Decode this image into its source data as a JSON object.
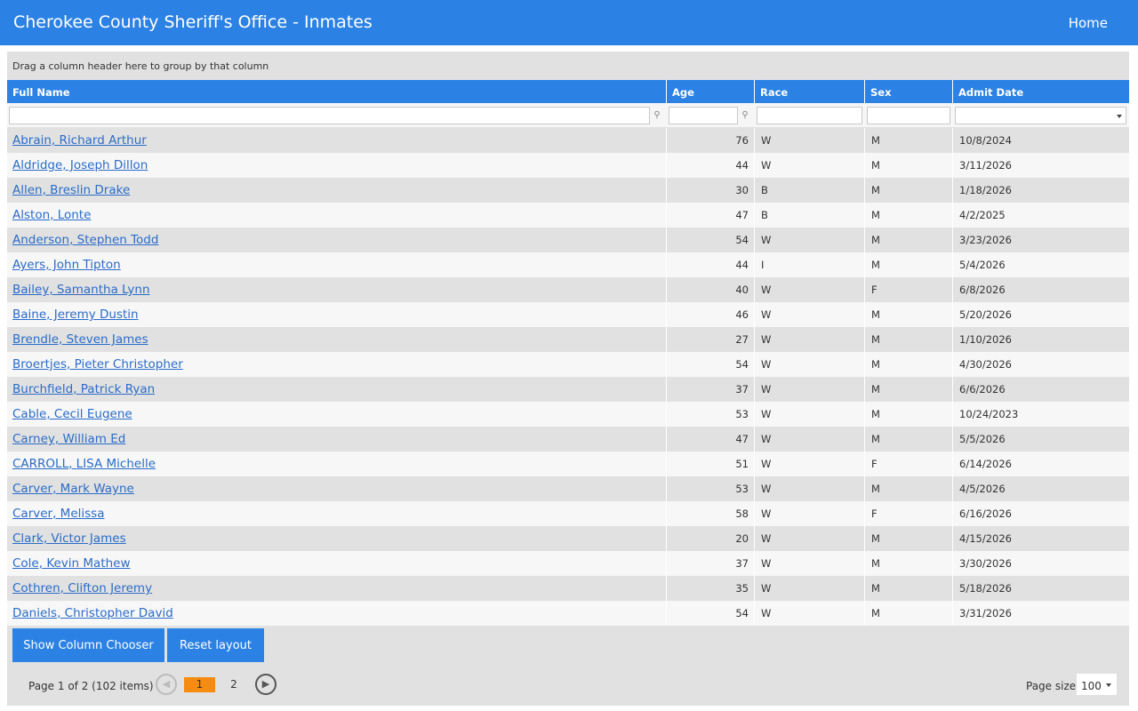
{
  "header": {
    "title": "Cherokee County Sheriff's Office - Inmates",
    "home_label": "Home"
  },
  "grid": {
    "group_panel_text": "Drag a column header here to group by that column",
    "columns": [
      "Full Name",
      "Age",
      "Race",
      "Sex",
      "Admit Date"
    ],
    "rows": [
      {
        "name": "Abrain, Richard Arthur",
        "age": "76",
        "race": "W",
        "sex": "M",
        "admit": "10/8/2024"
      },
      {
        "name": "Aldridge, Joseph Dillon",
        "age": "44",
        "race": "W",
        "sex": "M",
        "admit": "3/11/2026"
      },
      {
        "name": "Allen, Breslin Drake",
        "age": "30",
        "race": "B",
        "sex": "M",
        "admit": "1/18/2026"
      },
      {
        "name": "Alston, Lonte",
        "age": "47",
        "race": "B",
        "sex": "M",
        "admit": "4/2/2025"
      },
      {
        "name": "Anderson, Stephen Todd",
        "age": "54",
        "race": "W",
        "sex": "M",
        "admit": "3/23/2026"
      },
      {
        "name": "Ayers, John Tipton",
        "age": "44",
        "race": "I",
        "sex": "M",
        "admit": "5/4/2026"
      },
      {
        "name": "Bailey, Samantha Lynn",
        "age": "40",
        "race": "W",
        "sex": "F",
        "admit": "6/8/2026"
      },
      {
        "name": "Baine, Jeremy Dustin",
        "age": "46",
        "race": "W",
        "sex": "M",
        "admit": "5/20/2026"
      },
      {
        "name": "Brendle, Steven James",
        "age": "27",
        "race": "W",
        "sex": "M",
        "admit": "1/10/2026"
      },
      {
        "name": "Broertjes, Pieter Christopher",
        "age": "54",
        "race": "W",
        "sex": "M",
        "admit": "4/30/2026"
      },
      {
        "name": "Burchfield, Patrick Ryan",
        "age": "37",
        "race": "W",
        "sex": "M",
        "admit": "6/6/2026"
      },
      {
        "name": "Cable, Cecil Eugene",
        "age": "53",
        "race": "W",
        "sex": "M",
        "admit": "10/24/2023"
      },
      {
        "name": "Carney, William Ed",
        "age": "47",
        "race": "W",
        "sex": "M",
        "admit": "5/5/2026"
      },
      {
        "name": "CARROLL, LISA Michelle",
        "age": "51",
        "race": "W",
        "sex": "F",
        "admit": "6/14/2026"
      },
      {
        "name": "Carver, Mark Wayne",
        "age": "53",
        "race": "W",
        "sex": "M",
        "admit": "4/5/2026"
      },
      {
        "name": "Carver, Melissa",
        "age": "58",
        "race": "W",
        "sex": "F",
        "admit": "6/16/2026"
      },
      {
        "name": "Clark, Victor James",
        "age": "20",
        "race": "W",
        "sex": "M",
        "admit": "4/15/2026"
      },
      {
        "name": "Cole, Kevin Mathew",
        "age": "37",
        "race": "W",
        "sex": "M",
        "admit": "3/30/2026"
      },
      {
        "name": "Cothren, Clifton Jeremy",
        "age": "35",
        "race": "W",
        "sex": "M",
        "admit": "5/18/2026"
      },
      {
        "name": "Daniels, Christopher David",
        "age": "54",
        "race": "W",
        "sex": "M",
        "admit": "3/31/2026"
      }
    ]
  },
  "buttons": {
    "column_chooser": "Show Column Chooser",
    "reset_layout": "Reset layout"
  },
  "pager": {
    "summary": "Page 1 of 2 (102 items)",
    "pages": [
      "1",
      "2"
    ],
    "current_page": "1",
    "page_size_label": "Page size:",
    "page_size": "100"
  },
  "icons": {
    "filter": "filter-icon",
    "prev": "chevron-left-icon",
    "next": "chevron-right-icon",
    "dropdown": "chevron-down-icon"
  },
  "colors": {
    "accent": "#2b82e4",
    "active_page": "#f58b10",
    "link": "#2b6cc8"
  }
}
